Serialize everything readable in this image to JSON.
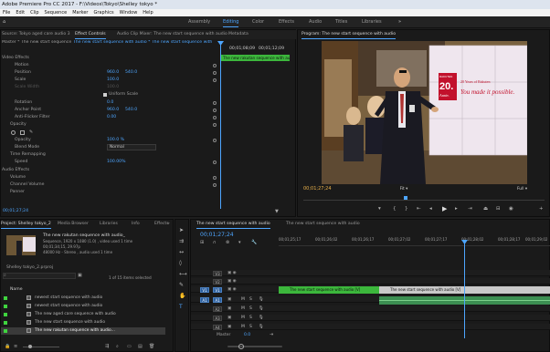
{
  "window": {
    "title": "Adobe Premiere Pro CC 2017 - F:\\Videos\\Tokyo\\Shelley tokyo *"
  },
  "menu": [
    "File",
    "Edit",
    "Clip",
    "Sequence",
    "Marker",
    "Graphics",
    "Window",
    "Help"
  ],
  "workspaces": [
    "Assembly",
    "Editing",
    "Color",
    "Effects",
    "Audio",
    "Titles",
    "Libraries"
  ],
  "workspaces_more": "»",
  "source_panel": {
    "tabs": [
      "Source: Tokyo aged care audio 3",
      "Effect Controls",
      "Audio Clip Mixer: The new start sequence with audio",
      "Metadata"
    ],
    "header_master": "Master * The new start sequence with audi...",
    "header_clip": "The new start sequence with audio * The new start sequence with...",
    "timecode_start": "00;01;08;09",
    "timecode_end": "00;01;12;09",
    "clip_label": "The new rakutan sequence with audio",
    "sections": {
      "video_effects": "Video Effects",
      "motion": "Motion",
      "position": {
        "label": "Position",
        "x": "960.0",
        "y": "540.0"
      },
      "scale": {
        "label": "Scale",
        "value": "100.0"
      },
      "scale_width": {
        "label": "Scale Width",
        "value": "100.0"
      },
      "uniform_scale": "Uniform Scale",
      "rotation": {
        "label": "Rotation",
        "value": "0.0"
      },
      "anchor": {
        "label": "Anchor Point",
        "x": "960.0",
        "y": "540.0"
      },
      "anti_flicker": {
        "label": "Anti-Flicker Filter",
        "value": "0.00"
      },
      "opacity_section": "Opacity",
      "opacity": {
        "label": "Opacity",
        "value": "100.0 %"
      },
      "blend_mode": {
        "label": "Blend Mode",
        "value": "Normal"
      },
      "time_remapping": "Time Remapping",
      "speed": {
        "label": "Speed",
        "value": "100.00%"
      },
      "audio_effects": "Audio Effects",
      "volume": "Volume",
      "channel_volume": "Channel Volume",
      "panner": "Panner"
    },
    "footer_time": "00;01;27;24"
  },
  "program": {
    "title": "Program: The new start sequence with audio",
    "timecode": "00;01;27;24",
    "fit": "Fit",
    "quality": "Full",
    "scene": {
      "sign_top": "RAKUTEN",
      "sign_num": "20.",
      "sign_sub": "Anniv.",
      "sign_tag": "20 Years of Rakuten",
      "sign_made": "You made it possible."
    }
  },
  "project": {
    "tabs": [
      "Project: Shelley tokyo_2",
      "Media Browser",
      "Libraries",
      "Info",
      "Effects"
    ],
    "more": "»",
    "clip_name": "The new rakutan sequence with audio_",
    "clip_info1": "Sequence, 1920 x 1080 (1.0) , video used 1 time",
    "clip_info2": "00;01;34;15, 29.97p",
    "clip_info3": "48000 Hz - Stereo , audio used 1 time",
    "bin_name": "Shelley tokyo_2.prproj",
    "selected_count": "1 of 15 items selected",
    "name_col": "Name",
    "items": [
      "newest start sequence with audio",
      "newest start sequence with audio",
      "The new aged care sequence with audio",
      "The new start sequence with audio",
      "The new rakutan sequence with audio..."
    ]
  },
  "timeline": {
    "tab": "The new start sequence with audio",
    "tab2": "The new start sequence with audio",
    "timecode": "00;01;27;24",
    "ruler": [
      "00;01;25;17",
      "00;01;26;02",
      "00;01;26;17",
      "00;01;27;02",
      "00;01;27;17",
      "00;01;28;02",
      "00;01;28;17",
      "00;01;29;02"
    ],
    "tracks": [
      {
        "src": "",
        "name": "V3",
        "type": "video"
      },
      {
        "src": "",
        "name": "V2",
        "type": "video"
      },
      {
        "src": "V1",
        "name": "V1",
        "type": "video"
      },
      {
        "src": "A1",
        "name": "A1",
        "type": "audio"
      },
      {
        "src": "",
        "name": "A2",
        "type": "audio"
      },
      {
        "src": "",
        "name": "A3",
        "type": "audio"
      },
      {
        "src": "",
        "name": "A4",
        "type": "audio"
      }
    ],
    "master": {
      "label": "Master",
      "value": "0.0"
    },
    "clip_v1a": "The new start sequence with audio [V]",
    "clip_v1b": "The new start sequence with audio [V]",
    "mute": "M",
    "solo": "S"
  },
  "colors": {
    "accent": "#4ea6ff",
    "clip_video": "#9d6fb6",
    "clip_audio": "#3c8f52",
    "label_green": "#3fd43f"
  }
}
